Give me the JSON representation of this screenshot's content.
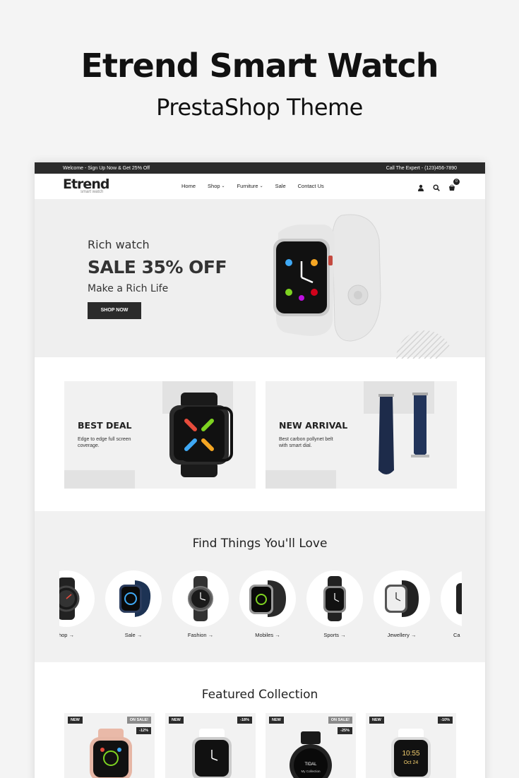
{
  "promo": {
    "title": "Etrend Smart Watch",
    "subtitle": "PrestaShop Theme"
  },
  "topbar": {
    "welcome": "Welcome - Sign Up Now & Get 25% Off",
    "phone": "Call The Expert - (123)456-7890"
  },
  "header": {
    "logo": "Etrend",
    "logo_sub": "smart watch",
    "nav": [
      {
        "label": "Home"
      },
      {
        "label": "Shop"
      },
      {
        "label": "Furniture"
      },
      {
        "label": "Sale"
      },
      {
        "label": "Contact Us"
      }
    ],
    "cart_count": "0",
    "icons": [
      "user-icon",
      "search-icon",
      "cart-icon"
    ]
  },
  "hero": {
    "eyebrow": "Rich watch",
    "headline": "SALE 35% OFF",
    "tagline": "Make a Rich Life",
    "button": "SHOP NOW"
  },
  "banners": [
    {
      "title": "BEST DEAL",
      "text": "Edge to edge full screen coverage."
    },
    {
      "title": "NEW ARRIVAL",
      "text": "Best carbon pollynet belt with smart dial."
    }
  ],
  "categories": {
    "title": "Find Things You'll Love",
    "items": [
      {
        "label": "hop →"
      },
      {
        "label": "Sale →"
      },
      {
        "label": "Fashion →"
      },
      {
        "label": "Mobiles →"
      },
      {
        "label": "Sports →"
      },
      {
        "label": "Jewellery →"
      },
      {
        "label": "Ca"
      }
    ]
  },
  "featured": {
    "title": "Featured Collection",
    "products": [
      {
        "new": "NEW",
        "sale": "ON SALE!",
        "discount": "-12%"
      },
      {
        "new": "NEW",
        "discount": "-18%"
      },
      {
        "new": "NEW",
        "sale": "ON SALE!",
        "discount": "-25%"
      },
      {
        "new": "NEW",
        "discount": "-10%"
      }
    ],
    "screen_texts": {
      "tidal": "TIDAL",
      "collection": "My Collection",
      "time": "10:55",
      "date": "Oct 24"
    }
  },
  "colors": {
    "dark": "#2b2b2b",
    "bg_light": "#efefef",
    "accent_gray": "#e2e2e2"
  }
}
